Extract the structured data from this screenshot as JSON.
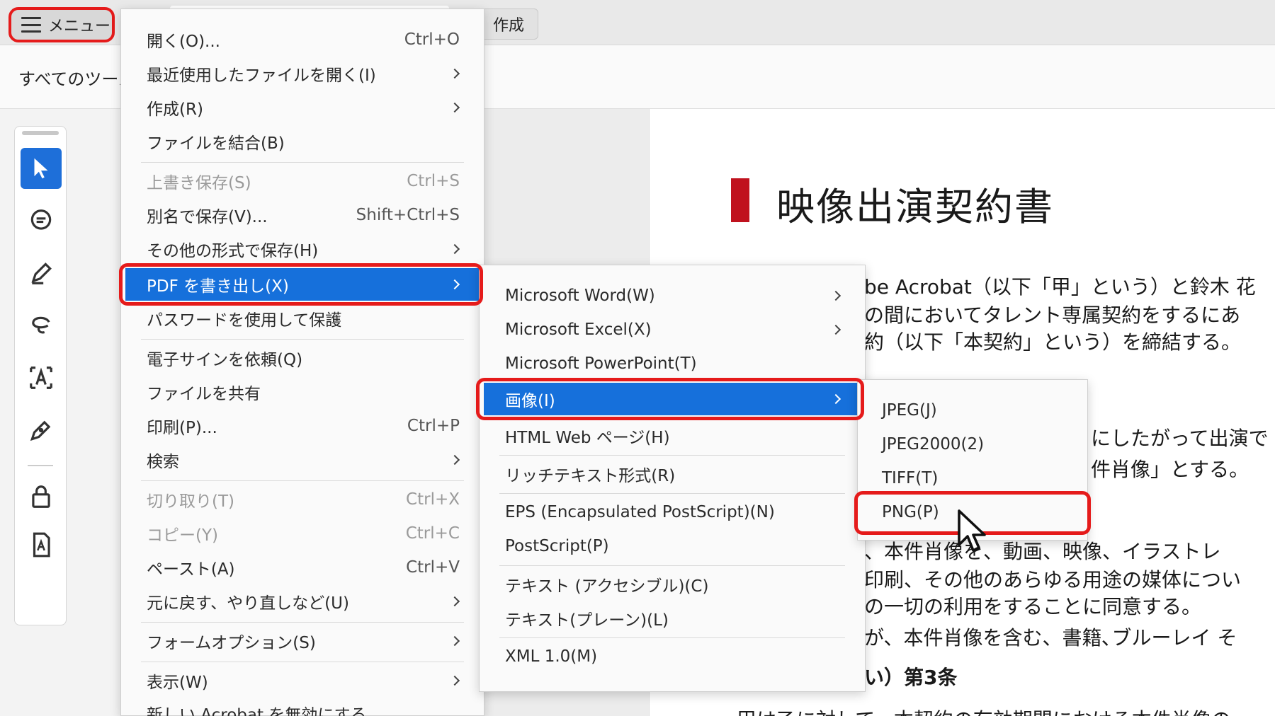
{
  "topbar": {
    "menu_label": "メニュー",
    "create_label": "作成"
  },
  "toolbar": {
    "all_tools_label": "すべてのツール"
  },
  "rail": {
    "more_label": "…"
  },
  "document": {
    "title": "映像出演契約書",
    "lines": [
      "be Acrobat（以下「甲」という）と鈴木 花",
      "の間においてタレント専属契約をするにあ",
      "約（以下「本契約」という）を締結する。",
      "にしたがって出演で",
      "件肖像」とする。",
      "、本件肖像を、動画、映像、イラストレ",
      "印刷、その他のあらゆる用途の媒体につい",
      "の一切の利用をすることに同意する。",
      "が、本件肖像を含む、書籍､ブルーレイ そ",
      "い）第3条",
      "甲は乙に対して、本契約の有効期間における本件肖像の"
    ]
  },
  "main_menu": {
    "items": [
      {
        "label": "開く(O)...",
        "shortcut": "Ctrl+O"
      },
      {
        "label": "最近使用したファイルを開く(I)"
      },
      {
        "label": "作成(R)"
      },
      {
        "label": "ファイルを結合(B)"
      },
      {
        "label": "上書き保存(S)",
        "shortcut": "Ctrl+S"
      },
      {
        "label": "別名で保存(V)...",
        "shortcut": "Shift+Ctrl+S"
      },
      {
        "label": "その他の形式で保存(H)"
      },
      {
        "label": "PDF を書き出し(X)"
      },
      {
        "label": "パスワードを使用して保護"
      },
      {
        "label": "電子サインを依頼(Q)"
      },
      {
        "label": "ファイルを共有"
      },
      {
        "label": "印刷(P)...",
        "shortcut": "Ctrl+P"
      },
      {
        "label": "検索"
      },
      {
        "label": "切り取り(T)",
        "shortcut": "Ctrl+X"
      },
      {
        "label": "コピー(Y)",
        "shortcut": "Ctrl+C"
      },
      {
        "label": "ペースト(A)",
        "shortcut": "Ctrl+V"
      },
      {
        "label": "元に戻す、やり直しなど(U)"
      },
      {
        "label": "フォームオプション(S)"
      },
      {
        "label": "表示(W)"
      },
      {
        "label": "新しい Acrobat を無効にする"
      }
    ]
  },
  "export_menu": {
    "items": [
      {
        "label": "Microsoft Word(W)"
      },
      {
        "label": "Microsoft Excel(X)"
      },
      {
        "label": "Microsoft PowerPoint(T)"
      },
      {
        "label": "画像(I)"
      },
      {
        "label": "HTML Web ページ(H)"
      },
      {
        "label": "リッチテキスト形式(R)"
      },
      {
        "label": "EPS (Encapsulated PostScript)(N)"
      },
      {
        "label": "PostScript(P)"
      },
      {
        "label": "テキスト (アクセシブル)(C)"
      },
      {
        "label": "テキスト(プレーン)(L)"
      },
      {
        "label": "XML 1.0(M)"
      }
    ]
  },
  "image_menu": {
    "items": [
      {
        "label": "JPEG(J)"
      },
      {
        "label": "JPEG2000(2)"
      },
      {
        "label": "TIFF(T)"
      },
      {
        "label": "PNG(P)"
      }
    ]
  },
  "colors": {
    "highlight": "#1670db",
    "annotation_red": "#e51b1b",
    "active_tool": "#1e6fd9",
    "title_mark": "#c0121e"
  }
}
